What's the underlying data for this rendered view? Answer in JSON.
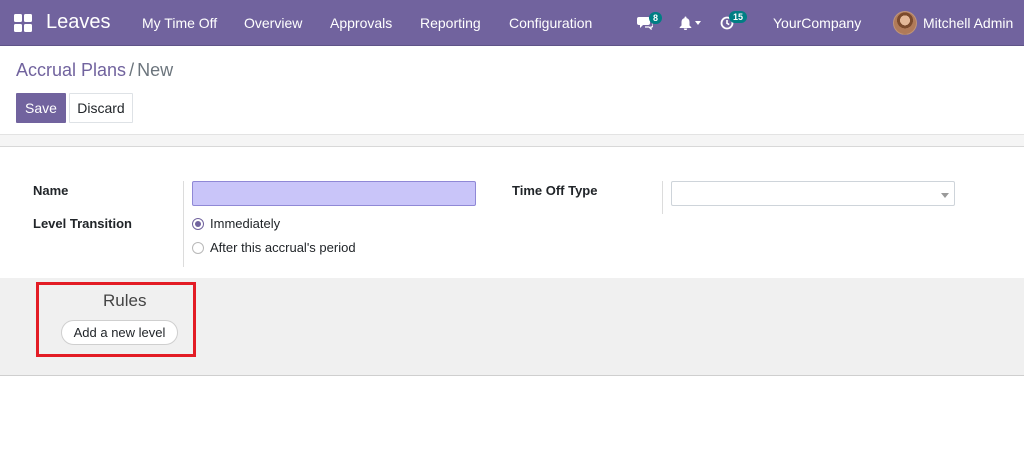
{
  "navbar": {
    "app_name": "Leaves",
    "menu": [
      "My Time Off",
      "Overview",
      "Approvals",
      "Reporting",
      "Configuration"
    ],
    "messages_count": "8",
    "activities_count": "15",
    "company": "YourCompany",
    "user": "Mitchell Admin",
    "icons": [
      "apps-icon",
      "chat-icon",
      "bell-icon",
      "clock-icon"
    ],
    "accent_color": "#71639e"
  },
  "breadcrumb": {
    "parent": "Accrual Plans",
    "separator": "/",
    "current": "New"
  },
  "actions": {
    "save": "Save",
    "discard": "Discard"
  },
  "form": {
    "name_label": "Name",
    "name_value": "",
    "level_transition_label": "Level Transition",
    "options": [
      "Immediately",
      "After this accrual's period"
    ],
    "selected_option": "Immediately",
    "time_off_type_label": "Time Off Type",
    "time_off_type_value": ""
  },
  "rules": {
    "title": "Rules",
    "add_level": "Add a new level",
    "highlight_color": "#e31c25"
  }
}
